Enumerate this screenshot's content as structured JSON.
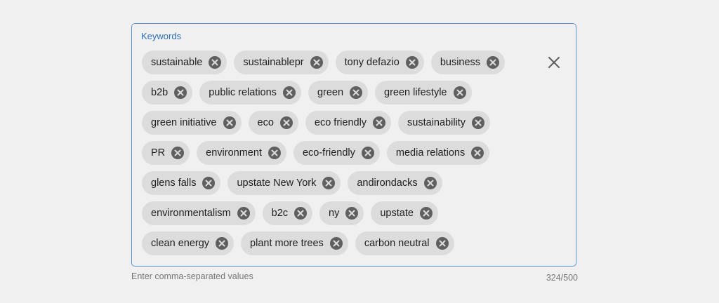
{
  "field": {
    "label": "Keywords",
    "clear_icon": "close-icon",
    "chip_remove_icon": "cancel-circle-icon"
  },
  "rows": [
    [
      "sustainable",
      "sustainablepr",
      "tony defazio",
      "business"
    ],
    [
      "b2b",
      "public relations",
      "green",
      "green lifestyle"
    ],
    [
      "green initiative",
      "eco",
      "eco friendly",
      "sustainability"
    ],
    [
      "PR",
      "environment",
      "eco-friendly",
      "media relations"
    ],
    [
      "glens falls",
      "upstate New York",
      "andirondacks"
    ],
    [
      "environmentalism",
      "b2c",
      "ny",
      "upstate"
    ],
    [
      "clean energy",
      "plant more trees",
      "carbon neutral"
    ]
  ],
  "helper_text": "Enter comma-separated values",
  "counter": "324/500",
  "colors": {
    "background": "#f0f0f0",
    "border": "#5b93cf",
    "label": "#2f6fb3",
    "chip_bg": "#dcdcdc",
    "chip_remove": "#5f5f5f",
    "muted_text": "#767676"
  }
}
